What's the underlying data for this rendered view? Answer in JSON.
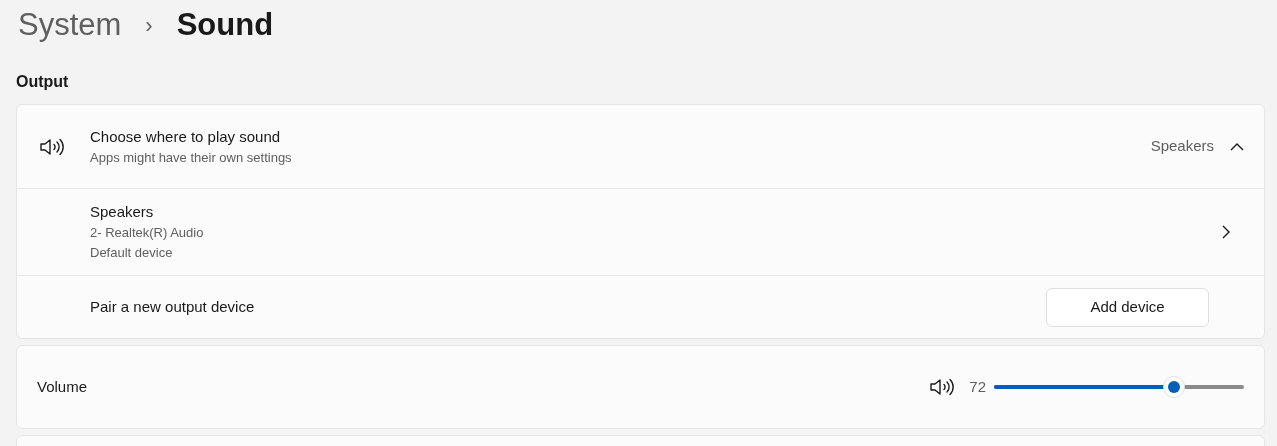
{
  "breadcrumb": {
    "parent": "System",
    "separator": "›",
    "current": "Sound"
  },
  "section_title": "Output",
  "output_card": {
    "title": "Choose where to play sound",
    "subtitle": "Apps might have their own settings",
    "value": "Speakers",
    "expanded": true,
    "device": {
      "name": "Speakers",
      "details": [
        "2- Realtek(R) Audio",
        "Default device"
      ]
    },
    "pair": {
      "label": "Pair a new output device",
      "button": "Add device"
    }
  },
  "volume": {
    "label": "Volume",
    "reading": "72",
    "level": 0.72
  }
}
